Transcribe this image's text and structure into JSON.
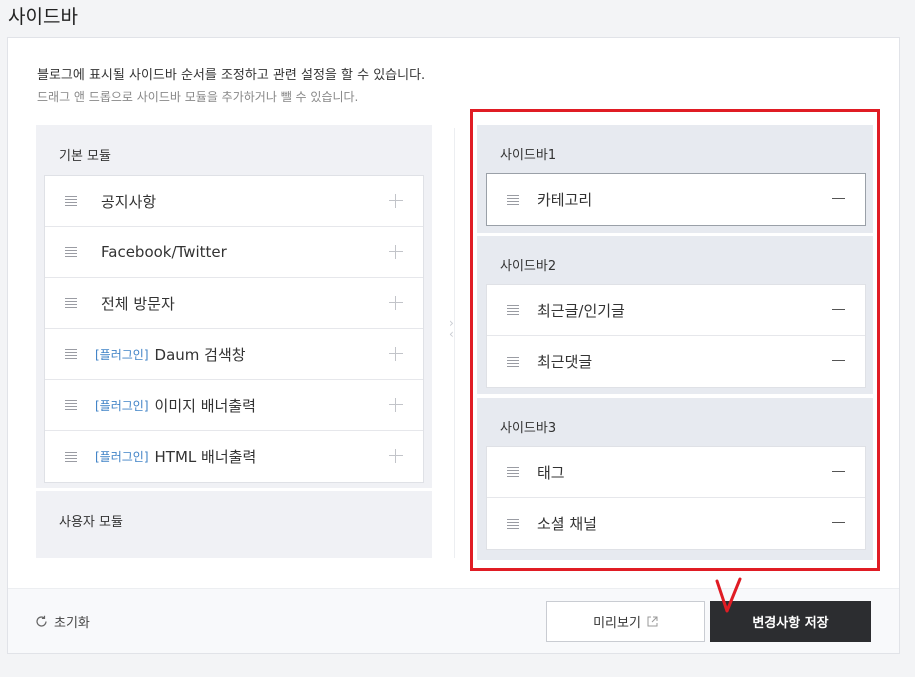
{
  "page": {
    "title": "사이드바"
  },
  "description": {
    "line1": "블로그에 표시될 사이드바 순서를 조정하고 관련 설정을 할 수 있습니다.",
    "line2": "드래그 앤 드롭으로 사이드바 모듈을 추가하거나 뺄 수 있습니다."
  },
  "basic_modules": {
    "title": "기본 모듈",
    "items": [
      {
        "tag": "",
        "label": "공지사항"
      },
      {
        "tag": "",
        "label": "Facebook/Twitter"
      },
      {
        "tag": "",
        "label": "전체 방문자"
      },
      {
        "tag": "[플러그인]",
        "label": "Daum 검색창"
      },
      {
        "tag": "[플러그인]",
        "label": "이미지 배너출력"
      },
      {
        "tag": "[플러그인]",
        "label": "HTML 배너출력"
      }
    ]
  },
  "user_modules": {
    "title": "사용자 모듈"
  },
  "sidebars": [
    {
      "title": "사이드바1",
      "items": [
        {
          "label": "카테고리"
        }
      ]
    },
    {
      "title": "사이드바2",
      "items": [
        {
          "label": "최근글/인기글"
        },
        {
          "label": "최근댓글"
        }
      ]
    },
    {
      "title": "사이드바3",
      "items": [
        {
          "label": "태그"
        },
        {
          "label": "소셜 채널"
        }
      ]
    }
  ],
  "footer": {
    "reset_label": "초기화",
    "preview_label": "미리보기",
    "save_label": "변경사항 저장"
  },
  "colors": {
    "highlight_border": "#e01c24",
    "plugin_tag": "#3f82c6",
    "save_button_bg": "#2c2d30"
  },
  "icons": {
    "drag_handle": "drag-handle-icon",
    "add": "plus-icon",
    "remove": "minus-icon",
    "reset": "refresh-icon",
    "external": "external-link-icon"
  }
}
